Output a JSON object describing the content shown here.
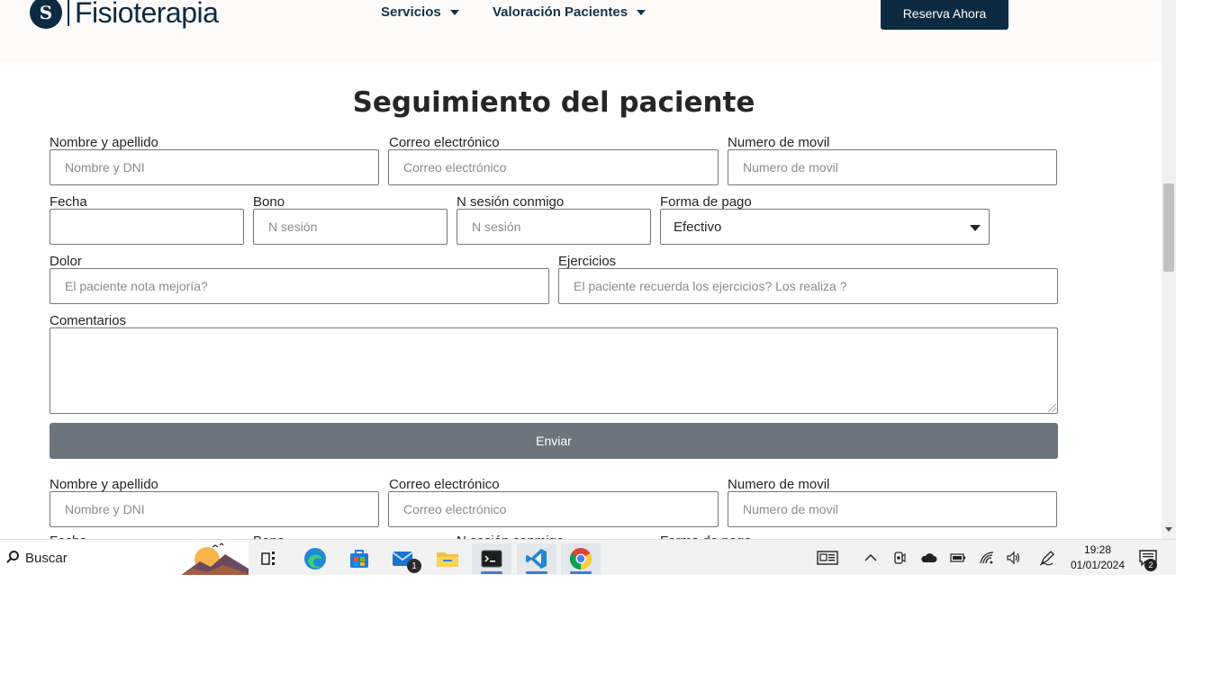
{
  "header": {
    "logo_mark": "S",
    "logo_text": "Fisioterapia",
    "nav": [
      {
        "label": "Servicios"
      },
      {
        "label": "Valoración Pacientes"
      }
    ],
    "cta_label": "Reserva Ahora"
  },
  "form": {
    "title": "Seguimiento del paciente",
    "name_label": "Nombre y apellido",
    "name_placeholder": "Nombre y DNI",
    "email_label": "Correo electrónico",
    "email_placeholder": "Correo electrónico",
    "phone_label": "Numero de movil",
    "phone_placeholder": "Numero  de movil",
    "date_label": "Fecha",
    "date_value": "",
    "bono_label": "Bono",
    "bono_placeholder": "N sesión",
    "session_label": "N sesión conmigo",
    "session_placeholder": "N sesión",
    "payment_label": "Forma de pago",
    "payment_selected": "Efectivo",
    "pain_label": "Dolor",
    "pain_placeholder": "El paciente nota mejoría?",
    "exercises_label": "Ejercicios",
    "exercises_placeholder": "El paciente recuerda los ejercicios? Los realiza ?",
    "comments_label": "Comentarios",
    "submit_label": "Enviar"
  },
  "form2": {
    "name_label": "Nombre y apellido",
    "name_placeholder": "Nombre y DNI",
    "email_label": "Correo electrónico",
    "email_placeholder": "Correo electrónico",
    "phone_label": "Numero de movil",
    "phone_placeholder": "Numero  de movil",
    "date_label": "Fecha",
    "bono_label": "Bono",
    "session_label": "N sesión conmigo",
    "payment_label": "Forma de pago"
  },
  "taskbar": {
    "search_label": "Buscar",
    "apps": [
      "task-view-icon",
      "edge-icon",
      "store-icon",
      "mail-icon",
      "file-explorer-icon",
      "terminal-icon",
      "vscode-icon",
      "chrome-icon"
    ],
    "mail_badge": "1",
    "time": "19:28",
    "date": "01/01/2024",
    "notification_count": "2"
  },
  "colors": {
    "brand": "#0d2b40",
    "submit": "#6c757d",
    "active_underline": "#3b7bd4"
  }
}
